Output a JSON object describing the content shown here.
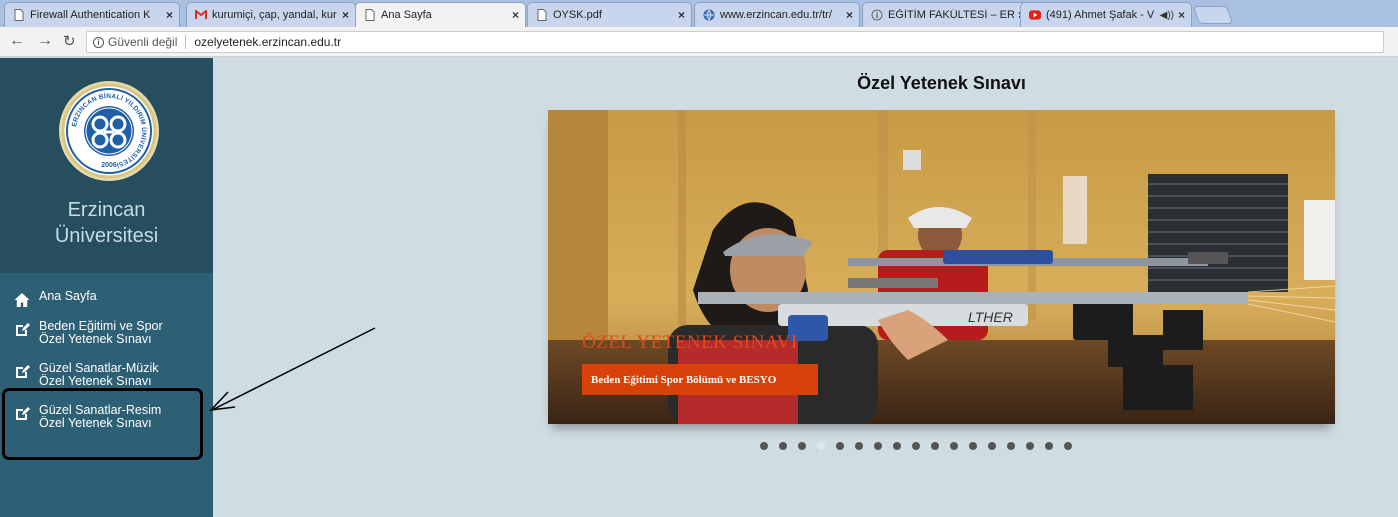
{
  "browser": {
    "tabs": [
      {
        "title": "Firewall Authentication K",
        "favicon": "page-icon",
        "active": false
      },
      {
        "title": "kurumiçi, çap, yandal, kur",
        "favicon": "gmail-icon",
        "active": false
      },
      {
        "title": "Ana Sayfa",
        "favicon": "page-icon",
        "active": true
      },
      {
        "title": "OYSK.pdf",
        "favicon": "page-icon",
        "active": false
      },
      {
        "title": "www.erzincan.edu.tr/tr/",
        "favicon": "globe-icon",
        "active": false
      },
      {
        "title": "EĞİTİM FAKÜLTESİ – ERZİ",
        "favicon": "info-icon",
        "active": false
      },
      {
        "title": "(491) Ahmet Şafak - V",
        "favicon": "youtube-icon",
        "active": false,
        "audio": true
      }
    ],
    "address": {
      "security_label": "Güvenli değil",
      "url": "ozelyetenek.erzincan.edu.tr"
    },
    "colors": {
      "tab_strip": "#a9c0e0",
      "youtube_red": "#e62117",
      "gmail_red": "#d93025"
    }
  },
  "sidebar": {
    "university_name": [
      "Erzincan",
      "Üniversitesi"
    ],
    "logo_text": "ERZİNCAN BİNALİ YILDIRIM ÜNİVERSİTESİ",
    "logo_year": "2006",
    "menu": [
      {
        "label": [
          "Ana Sayfa"
        ],
        "icon": "home-icon"
      },
      {
        "label": [
          "Beden Eğitimi ve Spor",
          "Özel Yetenek Sınavı"
        ],
        "icon": "edit-icon"
      },
      {
        "label": [
          "Güzel Sanatlar-Müzik",
          "Özel Yetenek Sınavı"
        ],
        "icon": "edit-icon"
      },
      {
        "label": [
          "Güzel Sanatlar-Resim",
          "Özel Yetenek Sınavı"
        ],
        "icon": "edit-icon"
      }
    ],
    "colors": {
      "background": "#2d5f75",
      "header_background": "#264e5f"
    }
  },
  "main": {
    "title": "Özel Yetenek Sınavı",
    "slide": {
      "heading": "ÖZEL YETENEK SINAVI",
      "caption": "Beden Eğitimi Spor Bölümü ve BESYO",
      "rifle_text": "LTHER"
    },
    "slider_dot_count": 17,
    "slider_active_dot": 4,
    "colors": {
      "accent": "#d9410a",
      "background": "#cfdde2"
    }
  }
}
